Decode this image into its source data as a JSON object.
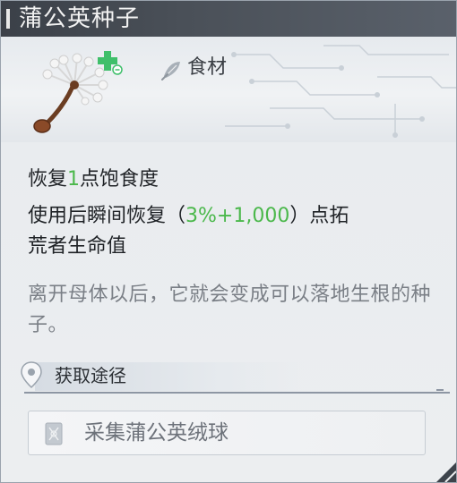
{
  "item": {
    "name": "蒲公英种子",
    "category": "食材",
    "icon": "dandelion-seed-icon",
    "badge_icon": "plus-heal-icon",
    "category_icon": "food-leaf-icon"
  },
  "effects": {
    "line1_prefix": "恢复",
    "line1_value": "1",
    "line1_suffix": "点饱食度",
    "line2_prefix": "使用后瞬间恢复（",
    "line2_value": "3%+1,000",
    "line2_suffix": "）点拓",
    "line3": "荒者生命值"
  },
  "description": "离开母体以后，它就会变成可以落地生根的种子。",
  "source": {
    "title": "获取途径",
    "pin_icon": "location-pin-icon",
    "method_label": "采集蒲公英绒球",
    "method_icon": "gather-card-icon"
  },
  "colors": {
    "title_bar": "#4a5058",
    "highlight_green": "#4bb84b",
    "description_gray": "#7a7f86",
    "badge_green": "#3fbf6a"
  }
}
